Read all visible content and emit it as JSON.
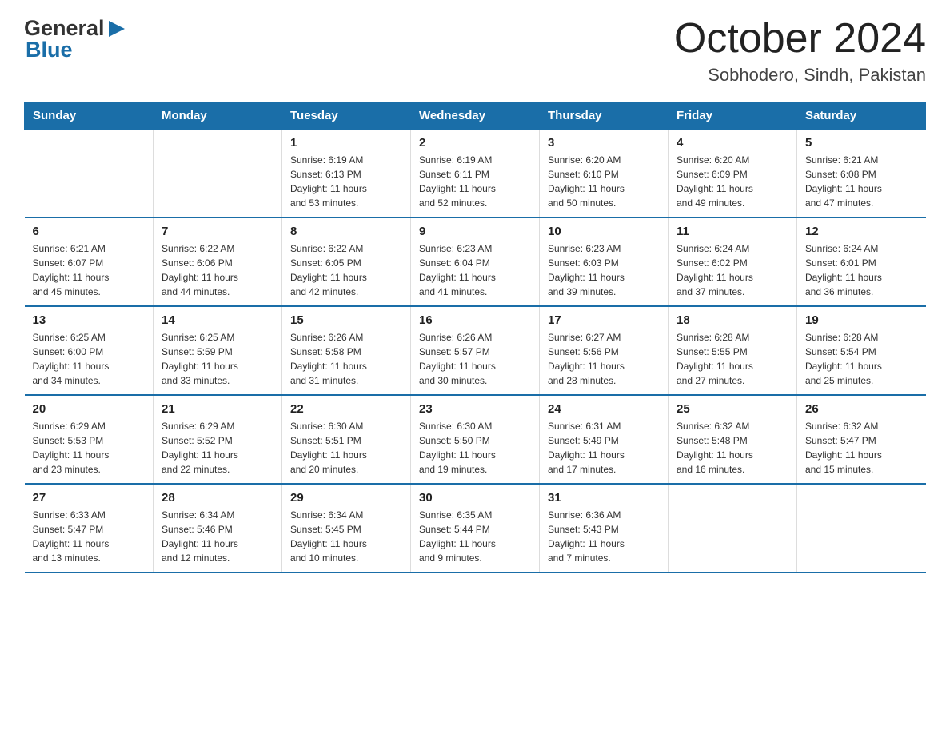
{
  "logo": {
    "general": "General",
    "arrow": "▶",
    "blue": "Blue"
  },
  "title": "October 2024",
  "subtitle": "Sobhodero, Sindh, Pakistan",
  "days_of_week": [
    "Sunday",
    "Monday",
    "Tuesday",
    "Wednesday",
    "Thursday",
    "Friday",
    "Saturday"
  ],
  "weeks": [
    [
      {
        "day": "",
        "info": ""
      },
      {
        "day": "",
        "info": ""
      },
      {
        "day": "1",
        "info": "Sunrise: 6:19 AM\nSunset: 6:13 PM\nDaylight: 11 hours\nand 53 minutes."
      },
      {
        "day": "2",
        "info": "Sunrise: 6:19 AM\nSunset: 6:11 PM\nDaylight: 11 hours\nand 52 minutes."
      },
      {
        "day": "3",
        "info": "Sunrise: 6:20 AM\nSunset: 6:10 PM\nDaylight: 11 hours\nand 50 minutes."
      },
      {
        "day": "4",
        "info": "Sunrise: 6:20 AM\nSunset: 6:09 PM\nDaylight: 11 hours\nand 49 minutes."
      },
      {
        "day": "5",
        "info": "Sunrise: 6:21 AM\nSunset: 6:08 PM\nDaylight: 11 hours\nand 47 minutes."
      }
    ],
    [
      {
        "day": "6",
        "info": "Sunrise: 6:21 AM\nSunset: 6:07 PM\nDaylight: 11 hours\nand 45 minutes."
      },
      {
        "day": "7",
        "info": "Sunrise: 6:22 AM\nSunset: 6:06 PM\nDaylight: 11 hours\nand 44 minutes."
      },
      {
        "day": "8",
        "info": "Sunrise: 6:22 AM\nSunset: 6:05 PM\nDaylight: 11 hours\nand 42 minutes."
      },
      {
        "day": "9",
        "info": "Sunrise: 6:23 AM\nSunset: 6:04 PM\nDaylight: 11 hours\nand 41 minutes."
      },
      {
        "day": "10",
        "info": "Sunrise: 6:23 AM\nSunset: 6:03 PM\nDaylight: 11 hours\nand 39 minutes."
      },
      {
        "day": "11",
        "info": "Sunrise: 6:24 AM\nSunset: 6:02 PM\nDaylight: 11 hours\nand 37 minutes."
      },
      {
        "day": "12",
        "info": "Sunrise: 6:24 AM\nSunset: 6:01 PM\nDaylight: 11 hours\nand 36 minutes."
      }
    ],
    [
      {
        "day": "13",
        "info": "Sunrise: 6:25 AM\nSunset: 6:00 PM\nDaylight: 11 hours\nand 34 minutes."
      },
      {
        "day": "14",
        "info": "Sunrise: 6:25 AM\nSunset: 5:59 PM\nDaylight: 11 hours\nand 33 minutes."
      },
      {
        "day": "15",
        "info": "Sunrise: 6:26 AM\nSunset: 5:58 PM\nDaylight: 11 hours\nand 31 minutes."
      },
      {
        "day": "16",
        "info": "Sunrise: 6:26 AM\nSunset: 5:57 PM\nDaylight: 11 hours\nand 30 minutes."
      },
      {
        "day": "17",
        "info": "Sunrise: 6:27 AM\nSunset: 5:56 PM\nDaylight: 11 hours\nand 28 minutes."
      },
      {
        "day": "18",
        "info": "Sunrise: 6:28 AM\nSunset: 5:55 PM\nDaylight: 11 hours\nand 27 minutes."
      },
      {
        "day": "19",
        "info": "Sunrise: 6:28 AM\nSunset: 5:54 PM\nDaylight: 11 hours\nand 25 minutes."
      }
    ],
    [
      {
        "day": "20",
        "info": "Sunrise: 6:29 AM\nSunset: 5:53 PM\nDaylight: 11 hours\nand 23 minutes."
      },
      {
        "day": "21",
        "info": "Sunrise: 6:29 AM\nSunset: 5:52 PM\nDaylight: 11 hours\nand 22 minutes."
      },
      {
        "day": "22",
        "info": "Sunrise: 6:30 AM\nSunset: 5:51 PM\nDaylight: 11 hours\nand 20 minutes."
      },
      {
        "day": "23",
        "info": "Sunrise: 6:30 AM\nSunset: 5:50 PM\nDaylight: 11 hours\nand 19 minutes."
      },
      {
        "day": "24",
        "info": "Sunrise: 6:31 AM\nSunset: 5:49 PM\nDaylight: 11 hours\nand 17 minutes."
      },
      {
        "day": "25",
        "info": "Sunrise: 6:32 AM\nSunset: 5:48 PM\nDaylight: 11 hours\nand 16 minutes."
      },
      {
        "day": "26",
        "info": "Sunrise: 6:32 AM\nSunset: 5:47 PM\nDaylight: 11 hours\nand 15 minutes."
      }
    ],
    [
      {
        "day": "27",
        "info": "Sunrise: 6:33 AM\nSunset: 5:47 PM\nDaylight: 11 hours\nand 13 minutes."
      },
      {
        "day": "28",
        "info": "Sunrise: 6:34 AM\nSunset: 5:46 PM\nDaylight: 11 hours\nand 12 minutes."
      },
      {
        "day": "29",
        "info": "Sunrise: 6:34 AM\nSunset: 5:45 PM\nDaylight: 11 hours\nand 10 minutes."
      },
      {
        "day": "30",
        "info": "Sunrise: 6:35 AM\nSunset: 5:44 PM\nDaylight: 11 hours\nand 9 minutes."
      },
      {
        "day": "31",
        "info": "Sunrise: 6:36 AM\nSunset: 5:43 PM\nDaylight: 11 hours\nand 7 minutes."
      },
      {
        "day": "",
        "info": ""
      },
      {
        "day": "",
        "info": ""
      }
    ]
  ]
}
